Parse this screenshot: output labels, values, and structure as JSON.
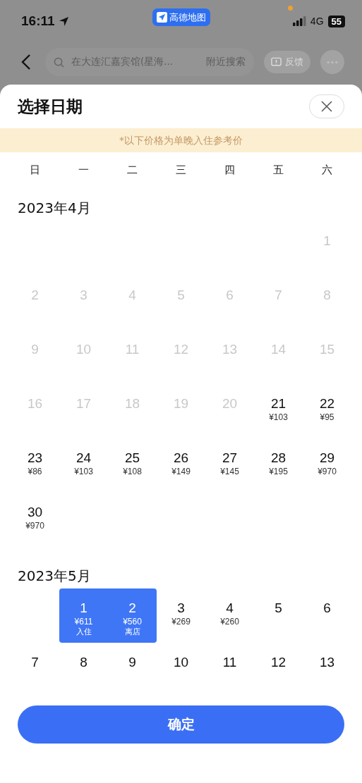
{
  "status_bar": {
    "time": "16:11",
    "app_badge": "高德地图",
    "network": "4G",
    "battery": "55"
  },
  "search_bar": {
    "placeholder": "在大连汇嘉宾馆(星海...",
    "nearby": "附近搜索",
    "feedback": "反馈"
  },
  "sheet": {
    "title": "选择日期",
    "notice": "*以下价格为单晚入住参考价",
    "weekdays": [
      "日",
      "一",
      "二",
      "三",
      "四",
      "五",
      "六"
    ],
    "months": [
      {
        "title": "2023年4月",
        "days": [
          {
            "kind": "blank"
          },
          {
            "kind": "blank"
          },
          {
            "kind": "blank"
          },
          {
            "kind": "blank"
          },
          {
            "kind": "blank"
          },
          {
            "kind": "blank"
          },
          {
            "kind": "day",
            "day": "1",
            "disabled": true,
            "selected": false
          },
          {
            "kind": "day",
            "day": "2",
            "disabled": true,
            "selected": false
          },
          {
            "kind": "day",
            "day": "3",
            "disabled": true,
            "selected": false
          },
          {
            "kind": "day",
            "day": "4",
            "disabled": true,
            "selected": false
          },
          {
            "kind": "day",
            "day": "5",
            "disabled": true,
            "selected": false
          },
          {
            "kind": "day",
            "day": "6",
            "disabled": true,
            "selected": false
          },
          {
            "kind": "day",
            "day": "7",
            "disabled": true,
            "selected": false
          },
          {
            "kind": "day",
            "day": "8",
            "disabled": true,
            "selected": false
          },
          {
            "kind": "day",
            "day": "9",
            "disabled": true,
            "selected": false
          },
          {
            "kind": "day",
            "day": "10",
            "disabled": true,
            "selected": false
          },
          {
            "kind": "day",
            "day": "11",
            "disabled": true,
            "selected": false
          },
          {
            "kind": "day",
            "day": "12",
            "disabled": true,
            "selected": false
          },
          {
            "kind": "day",
            "day": "13",
            "disabled": true,
            "selected": false
          },
          {
            "kind": "day",
            "day": "14",
            "disabled": true,
            "selected": false
          },
          {
            "kind": "day",
            "day": "15",
            "disabled": true,
            "selected": false
          },
          {
            "kind": "day",
            "day": "16",
            "disabled": true,
            "selected": false
          },
          {
            "kind": "day",
            "day": "17",
            "disabled": true,
            "selected": false
          },
          {
            "kind": "day",
            "day": "18",
            "disabled": true,
            "selected": false
          },
          {
            "kind": "day",
            "day": "19",
            "disabled": true,
            "selected": false
          },
          {
            "kind": "day",
            "day": "20",
            "disabled": true,
            "selected": false
          },
          {
            "kind": "day",
            "day": "21",
            "price": "¥103",
            "disabled": false,
            "selected": false
          },
          {
            "kind": "day",
            "day": "22",
            "price": "¥95",
            "disabled": false,
            "selected": false
          },
          {
            "kind": "day",
            "day": "23",
            "price": "¥86",
            "disabled": false,
            "selected": false
          },
          {
            "kind": "day",
            "day": "24",
            "price": "¥103",
            "disabled": false,
            "selected": false
          },
          {
            "kind": "day",
            "day": "25",
            "price": "¥108",
            "disabled": false,
            "selected": false
          },
          {
            "kind": "day",
            "day": "26",
            "price": "¥149",
            "disabled": false,
            "selected": false
          },
          {
            "kind": "day",
            "day": "27",
            "price": "¥145",
            "disabled": false,
            "selected": false
          },
          {
            "kind": "day",
            "day": "28",
            "price": "¥195",
            "disabled": false,
            "selected": false
          },
          {
            "kind": "day",
            "day": "29",
            "price": "¥970",
            "disabled": false,
            "selected": false
          },
          {
            "kind": "day",
            "day": "30",
            "price": "¥970",
            "disabled": false,
            "selected": false
          }
        ]
      },
      {
        "title": "2023年5月",
        "days": [
          {
            "kind": "blank"
          },
          {
            "kind": "day",
            "day": "1",
            "price": "¥611",
            "tag": "入住",
            "disabled": false,
            "selected": true
          },
          {
            "kind": "day",
            "day": "2",
            "price": "¥560",
            "tag": "离店",
            "disabled": false,
            "selected": true
          },
          {
            "kind": "day",
            "day": "3",
            "price": "¥269",
            "disabled": false,
            "selected": false
          },
          {
            "kind": "day",
            "day": "4",
            "price": "¥260",
            "disabled": false,
            "selected": false
          },
          {
            "kind": "day",
            "day": "5",
            "disabled": false,
            "selected": false
          },
          {
            "kind": "day",
            "day": "6",
            "disabled": false,
            "selected": false
          },
          {
            "kind": "day",
            "day": "7",
            "disabled": false,
            "selected": false
          },
          {
            "kind": "day",
            "day": "8",
            "disabled": false,
            "selected": false
          },
          {
            "kind": "day",
            "day": "9",
            "disabled": false,
            "selected": false
          },
          {
            "kind": "day",
            "day": "10",
            "disabled": false,
            "selected": false
          },
          {
            "kind": "day",
            "day": "11",
            "disabled": false,
            "selected": false
          },
          {
            "kind": "day",
            "day": "12",
            "disabled": false,
            "selected": false
          },
          {
            "kind": "day",
            "day": "13",
            "disabled": false,
            "selected": false
          }
        ]
      }
    ],
    "confirm": "确定"
  }
}
